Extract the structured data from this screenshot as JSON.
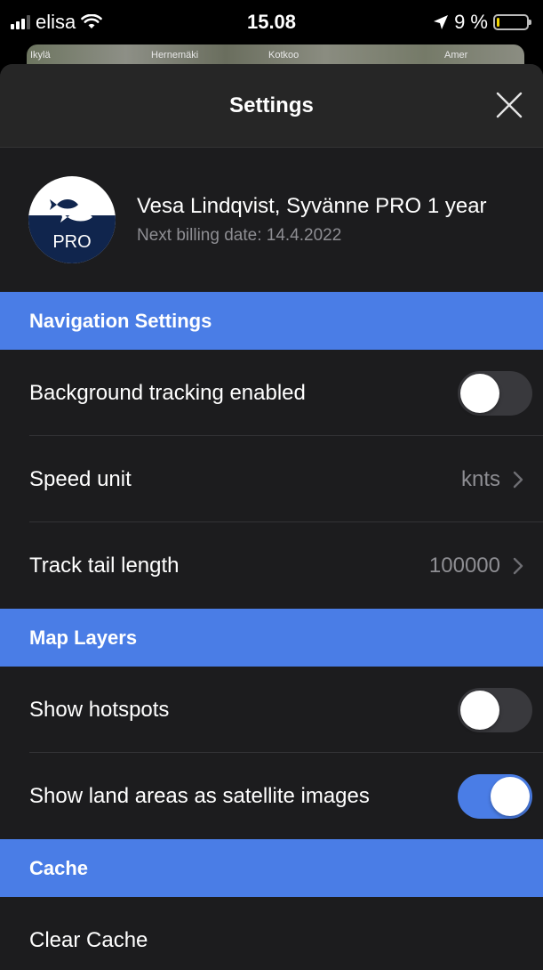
{
  "status_bar": {
    "carrier": "elisa",
    "time": "15.08",
    "battery": "9 %",
    "battery_level": 0.09
  },
  "map": {
    "labels": [
      "Ikylä",
      "Hernemäki",
      "Kotkoo",
      "Amer"
    ]
  },
  "header": {
    "title": "Settings"
  },
  "profile": {
    "avatar_badge": "PRO",
    "name": "Vesa Lindqvist, Syvänne PRO 1 year",
    "billing": "Next billing date: 14.4.2022"
  },
  "sections": {
    "navigation": {
      "title": "Navigation Settings",
      "background_tracking": {
        "label": "Background tracking enabled",
        "enabled": false
      },
      "speed_unit": {
        "label": "Speed unit",
        "value": "knts"
      },
      "track_tail": {
        "label": "Track tail length",
        "value": "100000"
      }
    },
    "map_layers": {
      "title": "Map Layers",
      "show_hotspots": {
        "label": "Show hotspots",
        "enabled": false
      },
      "show_land_satellite": {
        "label": "Show land areas as satellite images",
        "enabled": true
      }
    },
    "cache": {
      "title": "Cache",
      "clear_cache": {
        "label": "Clear Cache"
      }
    }
  },
  "colors": {
    "accent": "#4a7de6",
    "background": "#1c1c1e",
    "header_bg": "#262626",
    "avatar_navy": "#10254d",
    "battery_fill": "#f2d600"
  }
}
